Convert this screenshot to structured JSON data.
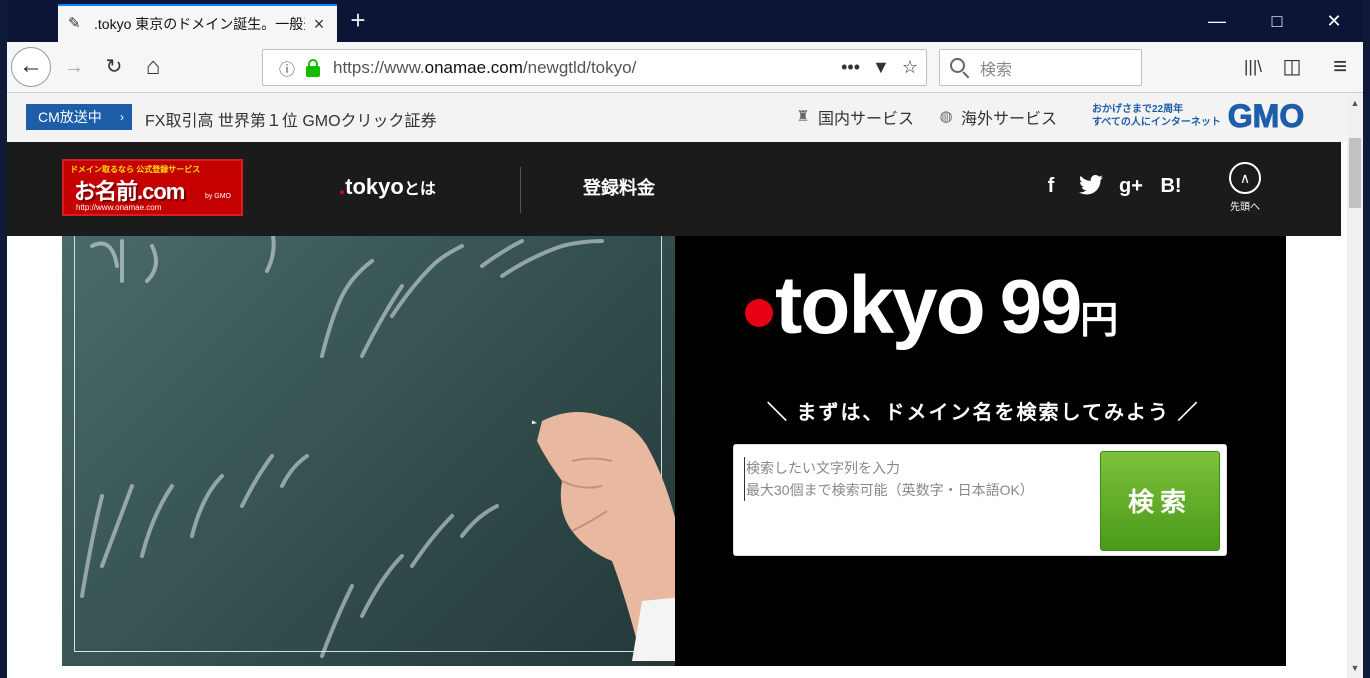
{
  "browser": {
    "tab_title": ".tokyo 東京のドメイン誕生。一般登",
    "url_prefix": "https://www.",
    "url_domain": "onamae.com",
    "url_path": "/newgtld/tokyo/",
    "search_placeholder": "検索",
    "controls": {
      "back": "←",
      "forward": "→",
      "reload": "↻",
      "home": "⌂",
      "more": "•••",
      "pocket": "▼",
      "bookmark": "☆",
      "library": "|||\\",
      "sidebar": "◫",
      "menu": "≡",
      "newtab": "+",
      "tab_close": "×",
      "minimize": "—",
      "maximize": "□",
      "close": "✕"
    }
  },
  "gmo_bar": {
    "cm_label": "CM放送中",
    "cm_arrow": "›",
    "fx_text": "FX取引高 世界第１位 GMOクリック証券",
    "domestic": "国内サービス",
    "overseas": "海外サービス",
    "tag_line1": "おかげさまで22周年",
    "tag_line2": "すべての人にインターネット",
    "logo_text": "GMO"
  },
  "header": {
    "logo_top": "ドメイン取るなら 公式登録サービス",
    "logo_main": "お名前.com",
    "logo_sub": "http://www.onamae.com",
    "logo_gmo": "by GMO",
    "nav_tokyo_dot": ".",
    "nav_tokyo": "tokyo",
    "nav_tokyo_suffix": "とは",
    "nav_pricing": "登録料金",
    "social_facebook": "f",
    "social_twitter": "♥",
    "social_gplus": "g+",
    "social_hatena": "B!",
    "totop_arrow": "∧",
    "totop_label": "先頭へ"
  },
  "hero": {
    "title_word": "tokyo",
    "price": "99",
    "yen": "円",
    "tagline": "＼ まずは、ドメイン名を検索してみよう ／",
    "search_placeholder_1": "検索したい文字列を入力",
    "search_placeholder_2": "最大30個まで検索可能（英数字・日本語OK）",
    "search_button": "検索"
  }
}
